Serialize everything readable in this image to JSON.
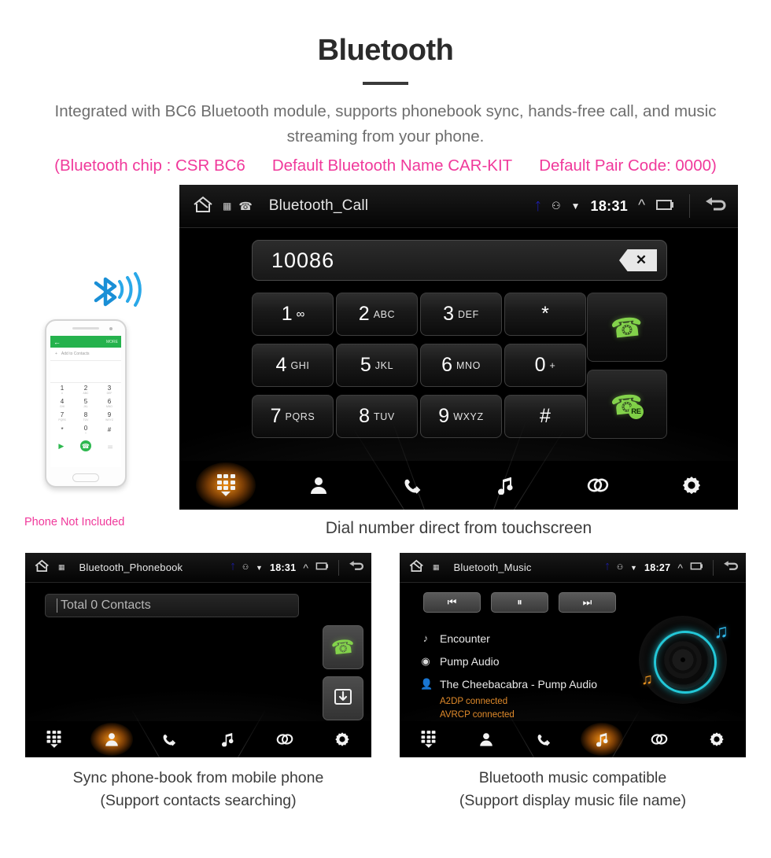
{
  "header": {
    "title": "Bluetooth",
    "subtitle": "Integrated with BC6 Bluetooth module, supports phonebook sync, hands-free call, and music streaming from your phone.",
    "specs": [
      "(Bluetooth chip : CSR BC6",
      "Default Bluetooth Name CAR-KIT",
      "Default Pair Code: 0000)"
    ],
    "accent_color": "#f0399b"
  },
  "dialer": {
    "statusbar": {
      "title": "Bluetooth_Call",
      "time": "18:31",
      "icons": [
        "home-icon",
        "sd-card-icon",
        "phone-icon",
        "bluetooth-icon",
        "dnd-icon",
        "wifi-icon",
        "chevron-up-icon",
        "recents-icon",
        "back-icon"
      ]
    },
    "number_value": "10086",
    "backspace_label": "✕",
    "keys": [
      {
        "digit": "1",
        "letters": "∞",
        "voicemail": true
      },
      {
        "digit": "2",
        "letters": "ABC"
      },
      {
        "digit": "3",
        "letters": "DEF"
      },
      {
        "digit": "*",
        "letters": ""
      },
      {
        "digit": "4",
        "letters": "GHI"
      },
      {
        "digit": "5",
        "letters": "JKL"
      },
      {
        "digit": "6",
        "letters": "MNO"
      },
      {
        "digit": "0",
        "letters": "+"
      },
      {
        "digit": "7",
        "letters": "PQRS"
      },
      {
        "digit": "8",
        "letters": "TUV"
      },
      {
        "digit": "9",
        "letters": "WXYZ"
      },
      {
        "digit": "#",
        "letters": ""
      }
    ],
    "call_button": "call-button",
    "redial_button": "redial-button",
    "redial_badge": "RE",
    "caption": "Dial number direct from touchscreen"
  },
  "nav": {
    "items": [
      {
        "name": "keypad",
        "icon": "keypad-icon"
      },
      {
        "name": "contacts",
        "icon": "contact-icon"
      },
      {
        "name": "call-log",
        "icon": "call-log-icon"
      },
      {
        "name": "music",
        "icon": "music-note-icon"
      },
      {
        "name": "pair",
        "icon": "link-icon"
      },
      {
        "name": "settings",
        "icon": "gear-icon"
      }
    ]
  },
  "phone_mock": {
    "screen_top_more": "MORE",
    "add_contact_label": "Add to Contacts",
    "keys": [
      {
        "d": "1",
        "l": "∞"
      },
      {
        "d": "2",
        "l": "ABC"
      },
      {
        "d": "3",
        "l": "DEF"
      },
      {
        "d": "4",
        "l": "GHI"
      },
      {
        "d": "5",
        "l": "JKL"
      },
      {
        "d": "6",
        "l": "MNO"
      },
      {
        "d": "7",
        "l": "PQRS"
      },
      {
        "d": "8",
        "l": "TUV"
      },
      {
        "d": "9",
        "l": "WXYZ"
      },
      {
        "d": "*",
        "l": ""
      },
      {
        "d": "0",
        "l": "+"
      },
      {
        "d": "#",
        "l": ""
      }
    ],
    "disclaimer": "Phone Not Included",
    "bluetooth_icon": "bluetooth-signal-icon"
  },
  "phonebook": {
    "statusbar": {
      "title": "Bluetooth_Phonebook",
      "time": "18:31"
    },
    "search_value": "Total 0 Contacts",
    "call_button": "call-button",
    "download_button": "download-contacts-button",
    "caption_line1": "Sync phone-book from mobile phone",
    "caption_line2": "(Support contacts searching)"
  },
  "music": {
    "statusbar": {
      "title": "Bluetooth_Music",
      "time": "18:27"
    },
    "controls": [
      {
        "name": "previous",
        "glyph": "⏮"
      },
      {
        "name": "pause",
        "glyph": "⏸"
      },
      {
        "name": "next",
        "glyph": "⏭"
      }
    ],
    "track_title": "Encounter",
    "album": "Pump Audio",
    "artist": "The Cheebacabra - Pump Audio",
    "status_a2dp": "A2DP connected",
    "status_avrcp": "AVRCP connected",
    "caption_line1": "Bluetooth music compatible",
    "caption_line2": "(Support display music file name)",
    "vinyl_accent": "#23c8d8"
  }
}
